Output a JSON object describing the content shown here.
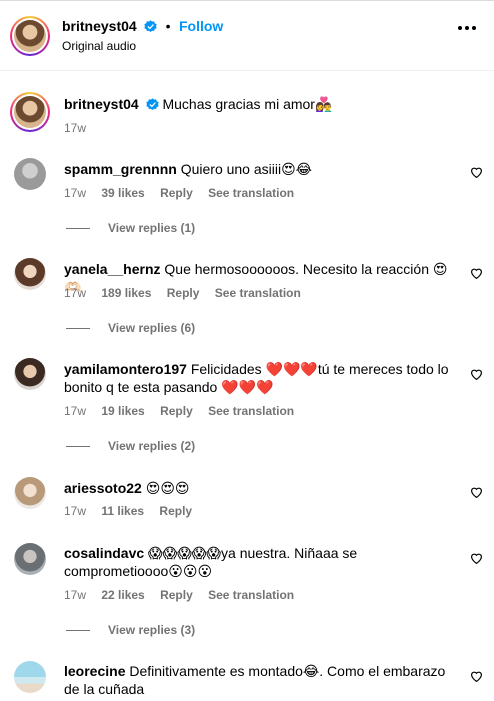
{
  "header": {
    "username": "britneyst04",
    "follow_label": "Follow",
    "subtitle": "Original audio"
  },
  "caption": {
    "username": "britneyst04",
    "text": "Muchas gracias mi amor👩‍❤️‍👨",
    "time": "17w"
  },
  "comments": [
    {
      "username": "spamm_grennnn",
      "text": "Quiero uno asiiii😍😂",
      "time": "17w",
      "likes": "39 likes",
      "reply": "Reply",
      "translate": "See translation",
      "view_replies": "View replies (1)"
    },
    {
      "username": "yanela__hernz",
      "text": "Que hermosoooooos. Necesito la reacción 😍🫶🏻",
      "time": "17w",
      "likes": "189 likes",
      "reply": "Reply",
      "translate": "See translation",
      "view_replies": "View replies (6)"
    },
    {
      "username": "yamilamontero197",
      "text": "Felicidades ❤️❤️❤️tú te mereces todo lo bonito q te esta pasando ❤️❤️❤️",
      "time": "17w",
      "likes": "19 likes",
      "reply": "Reply",
      "translate": "See translation",
      "view_replies": "View replies (2)"
    },
    {
      "username": "ariessoto22",
      "text": "😍😍😍",
      "time": "17w",
      "likes": "11 likes",
      "reply": "Reply"
    },
    {
      "username": "cosalindavc",
      "text": "😱😱😱😱😱ya nuestra. Niñaaa se comprometioooo😮😮😮",
      "time": "17w",
      "likes": "22 likes",
      "reply": "Reply",
      "translate": "See translation",
      "view_replies": "View replies (3)"
    },
    {
      "username": "leorecine",
      "text": "Definitivamente es montado😂. Como el embarazo de la cuñada"
    }
  ]
}
